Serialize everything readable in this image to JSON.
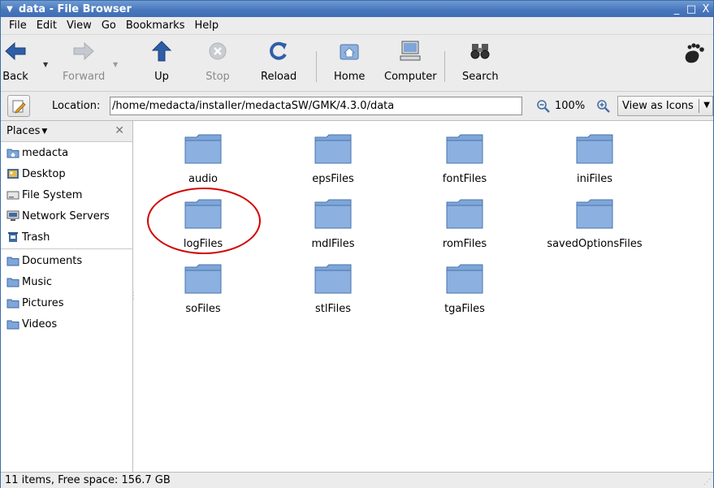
{
  "window": {
    "title": "data - File Browser",
    "minimize_glyph": "_",
    "maximize_glyph": "□",
    "close_glyph": "X"
  },
  "menubar": {
    "items": [
      {
        "label": "File"
      },
      {
        "label": "Edit"
      },
      {
        "label": "View"
      },
      {
        "label": "Go"
      },
      {
        "label": "Bookmarks"
      },
      {
        "label": "Help"
      }
    ]
  },
  "toolbar": {
    "back": {
      "label": "Back",
      "icon": "arrow-left-icon",
      "enabled": true
    },
    "forward": {
      "label": "Forward",
      "icon": "arrow-right-icon",
      "enabled": false
    },
    "up": {
      "label": "Up",
      "icon": "arrow-up-icon",
      "enabled": true
    },
    "stop": {
      "label": "Stop",
      "icon": "stop-icon",
      "enabled": false
    },
    "reload": {
      "label": "Reload",
      "icon": "reload-icon",
      "enabled": true
    },
    "home": {
      "label": "Home",
      "icon": "home-icon",
      "enabled": true
    },
    "computer": {
      "label": "Computer",
      "icon": "computer-icon",
      "enabled": true
    },
    "search": {
      "label": "Search",
      "icon": "binoculars-icon",
      "enabled": true
    }
  },
  "location": {
    "label": "Location:",
    "path": "/home/medacta/installer/medactaSW/GMK/4.3.0/data"
  },
  "zoom": {
    "level": "100%"
  },
  "view_mode": {
    "selected": "View as Icons"
  },
  "sidebar": {
    "header": "Places",
    "header_arrow": "▼",
    "close_glyph": "✕",
    "groups": [
      [
        {
          "label": "medacta",
          "icon": "home-folder-icon"
        },
        {
          "label": "Desktop",
          "icon": "desktop-icon"
        },
        {
          "label": "File System",
          "icon": "drive-icon"
        },
        {
          "label": "Network Servers",
          "icon": "network-icon"
        },
        {
          "label": "Trash",
          "icon": "trash-icon"
        }
      ],
      [
        {
          "label": "Documents",
          "icon": "folder-icon"
        },
        {
          "label": "Music",
          "icon": "folder-icon"
        },
        {
          "label": "Pictures",
          "icon": "folder-icon"
        },
        {
          "label": "Videos",
          "icon": "folder-icon"
        }
      ]
    ]
  },
  "files": [
    {
      "name": "audio"
    },
    {
      "name": "epsFiles"
    },
    {
      "name": "fontFiles"
    },
    {
      "name": "iniFiles"
    },
    {
      "name": "logFiles"
    },
    {
      "name": "mdlFiles"
    },
    {
      "name": "romFiles"
    },
    {
      "name": "savedOptionsFiles"
    },
    {
      "name": "soFiles"
    },
    {
      "name": "stlFiles"
    },
    {
      "name": "tgaFiles"
    }
  ],
  "status": {
    "text": "11 items, Free space: 156.7 GB"
  },
  "colors": {
    "titlebar": "#4a78bd",
    "folder": "#7ea6d8",
    "highlight_ring": "#d40000"
  }
}
